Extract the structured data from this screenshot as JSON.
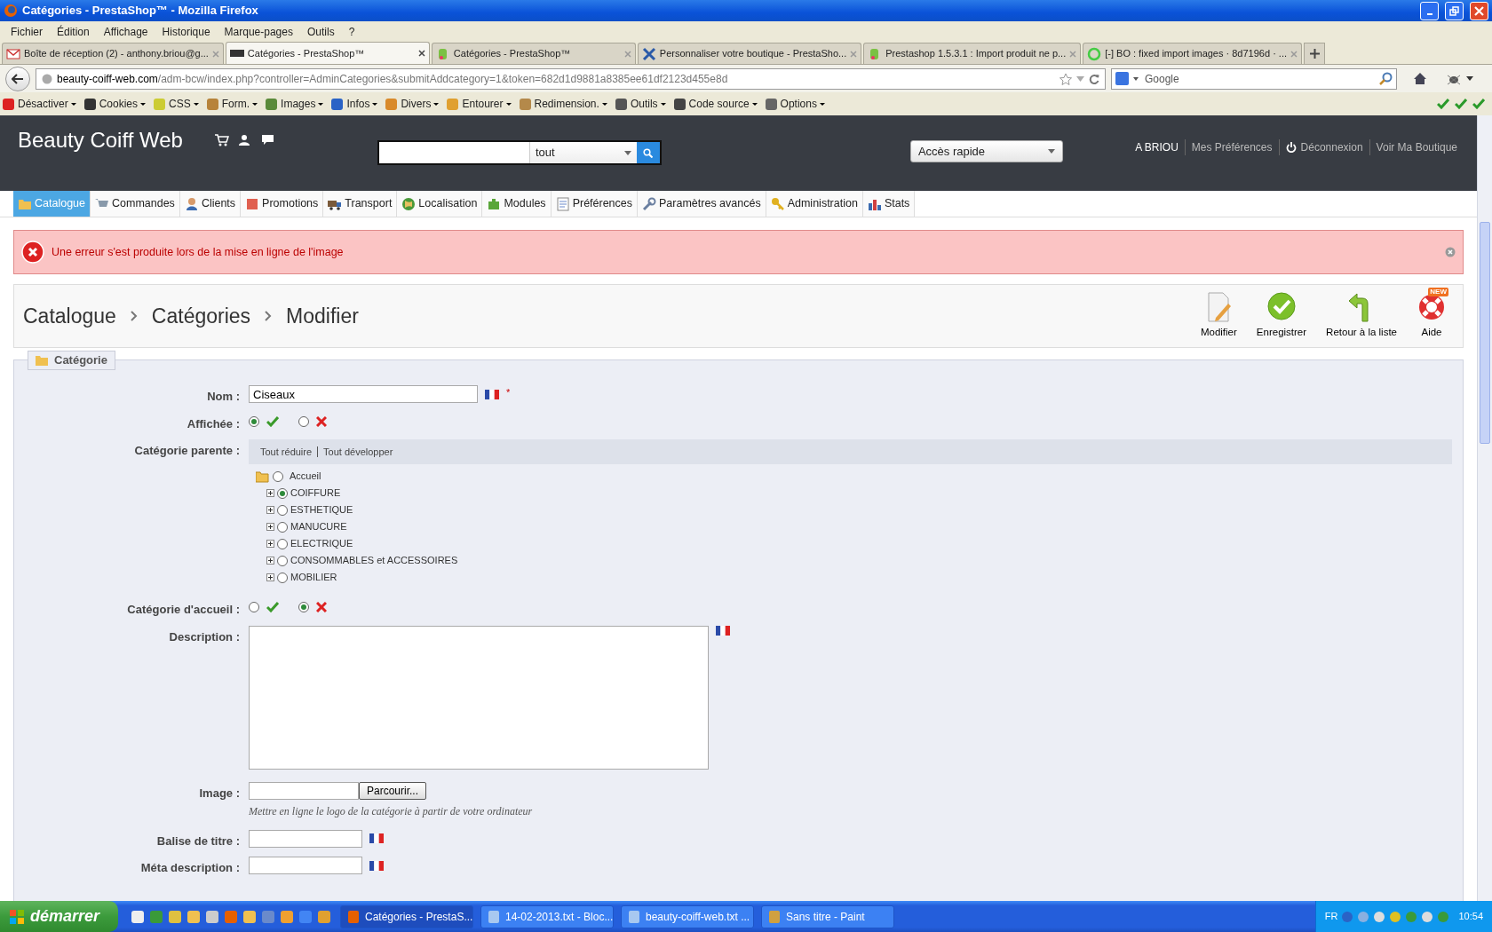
{
  "window": {
    "title": "Catégories - PrestaShop™ - Mozilla Firefox"
  },
  "menu": [
    "Fichier",
    "Édition",
    "Affichage",
    "Historique",
    "Marque-pages",
    "Outils",
    "?"
  ],
  "tabs": [
    {
      "label": "Boîte de réception (2) - anthony.briou@g...",
      "selected": false
    },
    {
      "label": "Catégories - PrestaShop™",
      "selected": true
    },
    {
      "label": "Catégories - PrestaShop™",
      "selected": false
    },
    {
      "label": "Personnaliser votre boutique - PrestaSho...",
      "selected": false
    },
    {
      "label": "Prestashop 1.5.3.1 : Import produit ne p...",
      "selected": false
    },
    {
      "label": "[-] BO : fixed import images · 8d7196d · ...",
      "selected": false
    }
  ],
  "address_bar": {
    "domain": "beauty-coiff-web.com",
    "path": "/adm-bcw/index.php?controller=AdminCategories&submitAddcategory=1&token=682d1d9881a8385ee61df2123d455e8d"
  },
  "search_bar": {
    "placeholder": "Google"
  },
  "dev_toolbar": [
    "Désactiver",
    "Cookies",
    "CSS",
    "Form.",
    "Images",
    "Infos",
    "Divers",
    "Entourer",
    "Redimension.",
    "Outils",
    "Code source",
    "Options"
  ],
  "header": {
    "shop_name": "Beauty Coiff Web",
    "search_scope": "tout",
    "quick_access": "Accès rapide",
    "links": [
      "A BRIOU",
      "Mes Préférences",
      "Déconnexion",
      "Voir Ma Boutique"
    ]
  },
  "nav": [
    {
      "label": "Catalogue",
      "selected": true
    },
    {
      "label": "Commandes",
      "selected": false
    },
    {
      "label": "Clients",
      "selected": false
    },
    {
      "label": "Promotions",
      "selected": false
    },
    {
      "label": "Transport",
      "selected": false
    },
    {
      "label": "Localisation",
      "selected": false
    },
    {
      "label": "Modules",
      "selected": false
    },
    {
      "label": "Préférences",
      "selected": false
    },
    {
      "label": "Paramètres avancés",
      "selected": false
    },
    {
      "label": "Administration",
      "selected": false
    },
    {
      "label": "Stats",
      "selected": false
    }
  ],
  "error": {
    "message": "Une erreur s'est produite lors de la mise en ligne de l'image"
  },
  "breadcrumb": [
    "Catalogue",
    "Catégories",
    "Modifier"
  ],
  "toolbar": [
    {
      "label": "Modifier"
    },
    {
      "label": "Enregistrer"
    },
    {
      "label": "Retour à la liste"
    },
    {
      "label": "Aide",
      "badge": "NEW"
    }
  ],
  "form": {
    "legend": "Catégorie",
    "fields": [
      {
        "kind": "text",
        "label": "Nom :",
        "value": "Ciseaux",
        "required_mark": "*"
      },
      {
        "kind": "toggle",
        "label": "Affichée :",
        "on": true
      },
      {
        "kind": "tree",
        "label": "Catégorie parente :",
        "actions": [
          "Tout réduire",
          "Tout développer"
        ],
        "root": {
          "label": "Accueil",
          "selected": false,
          "children": [
            {
              "label": "COIFFURE",
              "selected": true
            },
            {
              "label": "ESTHETIQUE",
              "selected": false
            },
            {
              "label": "MANUCURE",
              "selected": false
            },
            {
              "label": "ELECTRIQUE",
              "selected": false
            },
            {
              "label": "CONSOMMABLES et ACCESSOIRES",
              "selected": false
            },
            {
              "label": "MOBILIER",
              "selected": false
            }
          ]
        }
      },
      {
        "kind": "toggle",
        "label": "Catégorie d'accueil :",
        "on": false
      },
      {
        "kind": "textarea",
        "label": "Description :"
      },
      {
        "kind": "file",
        "label": "Image :",
        "button": "Parcourir...",
        "hint": "Mettre en ligne le logo de la catégorie à partir de votre ordinateur"
      },
      {
        "kind": "text",
        "label": "Balise de titre :"
      },
      {
        "kind": "text",
        "label": "Méta description :"
      }
    ]
  },
  "taskbar": {
    "start": "démarrer",
    "tasks": [
      {
        "label": "Catégories - PrestaS...",
        "selected": true
      },
      {
        "label": "14-02-2013.txt - Bloc...",
        "selected": false
      },
      {
        "label": "beauty-coiff-web.txt ...",
        "selected": false
      },
      {
        "label": "Sans titre - Paint",
        "selected": false
      }
    ],
    "language": "FR",
    "clock": "10:54"
  }
}
